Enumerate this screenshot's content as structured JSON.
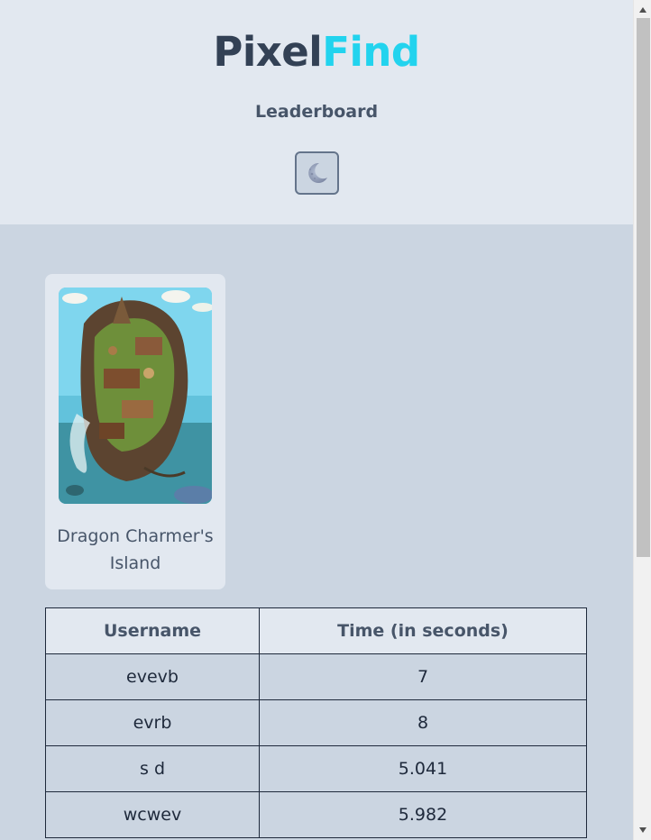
{
  "header": {
    "logo_part1": "Pixel",
    "logo_part2": "Find",
    "nav_leaderboard": "Leaderboard",
    "theme_toggle_icon": "moon-icon"
  },
  "levels": [
    {
      "title": "Dragon Charmer's Island",
      "image": "dragon-island-thumbnail"
    }
  ],
  "leaderboard": {
    "columns": [
      "Username",
      "Time (in seconds)"
    ],
    "rows": [
      {
        "username": "evevb",
        "time": "7"
      },
      {
        "username": "evrb",
        "time": "8"
      },
      {
        "username": "s d",
        "time": "5.041"
      },
      {
        "username": "wcwev",
        "time": "5.982"
      }
    ]
  },
  "colors": {
    "accent": "#22d3ee",
    "header_bg": "#e2e8f0",
    "page_bg": "#cbd5e1",
    "text": "#334155"
  }
}
